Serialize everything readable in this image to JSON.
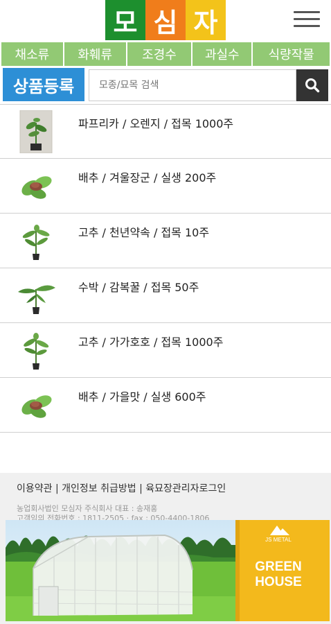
{
  "header": {
    "logo_chars": [
      "모",
      "심",
      "자"
    ],
    "logo_colors": [
      "#1d8f2e",
      "#f07d1b",
      "#f3c31a"
    ]
  },
  "categories": [
    "채소류",
    "화훼류",
    "조경수",
    "과실수",
    "식량작물"
  ],
  "search": {
    "register_label": "상품등록",
    "placeholder": "모종/묘목 검색"
  },
  "products": [
    {
      "text": "파프리카 / 오렌지 / 접목 1000주"
    },
    {
      "text": "배추 / 겨울장군 / 실생 200주"
    },
    {
      "text": "고추 / 천년약속 / 접목 10주"
    },
    {
      "text": "수박 / 감복꿀 / 접목 50주"
    },
    {
      "text": "고추 / 가가호호 / 접목 1000주"
    },
    {
      "text": "배추 / 가을맛 / 실생 600주"
    }
  ],
  "footer": {
    "link_terms": "이용약관",
    "link_privacy": "개인정보 취급방법",
    "link_login": "육묘장관리자로그인",
    "separator": " | ",
    "company_line1": "농업회사법인 모심자 주식회사 대표 : 송재홍",
    "company_line2": "고객임의 전화번호 : 1811-2505 · fax : 050-4400-1806"
  },
  "banner": {
    "brand": "JS METAL",
    "title_line1": "GREEN",
    "title_line2": "HOUSE"
  },
  "colors": {
    "category_bg": "#92c974",
    "register_bg": "#2d8fd6",
    "search_btn_bg": "#333333",
    "banner_panel": "#f3b91c"
  }
}
